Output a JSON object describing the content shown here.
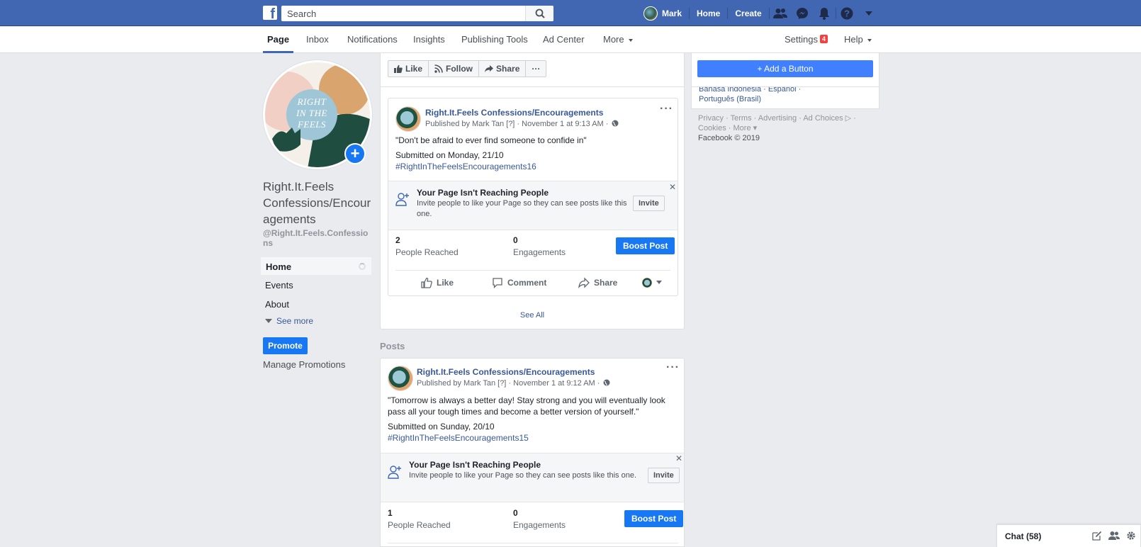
{
  "colors": {
    "brand_blue": "#4267b2",
    "link_blue": "#385898",
    "button_blue": "#1877f2",
    "page_bg": "#e9ebee",
    "notification_red": "#fa3e3e"
  },
  "topbar": {
    "search_placeholder": "Search",
    "user_name": "Mark",
    "home_label": "Home",
    "create_label": "Create",
    "icons": [
      "facebook-logo-icon",
      "search-icon",
      "friend-requests-icon",
      "messenger-icon",
      "notifications-bell-icon",
      "help-icon",
      "account-menu-caret-icon"
    ]
  },
  "pagenav": {
    "tabs": [
      {
        "label": "Page"
      },
      {
        "label": "Inbox"
      },
      {
        "label": "Notifications"
      },
      {
        "label": "Insights"
      },
      {
        "label": "Publishing Tools"
      },
      {
        "label": "Ad Center"
      },
      {
        "label": "More"
      }
    ],
    "settings_label": "Settings",
    "settings_badge": "4",
    "help_label": "Help"
  },
  "left": {
    "page_name": "Right.It.Feels Confessions/Encouragements",
    "page_handle": "@Right.It.Feels.Confessions",
    "profile_pic_text": "RIGHT IN THE FEELS",
    "nav": [
      {
        "label": "Home"
      },
      {
        "label": "Events"
      },
      {
        "label": "About"
      }
    ],
    "see_more": "See more",
    "promote": "Promote",
    "manage_promotions": "Manage Promotions"
  },
  "actions": {
    "like": "Like",
    "follow": "Follow",
    "share": "Share",
    "more": "···"
  },
  "right": {
    "add_button": "+ Add a Button",
    "languages_line1": "Bahasa Indonesia · Español ·",
    "languages_line2": "Português (Brasil)",
    "footer_line1": "Privacy · Terms · Advertising · Ad Choices ▷ ·",
    "footer_line2": "Cookies · More ▾",
    "footer_copyright": "Facebook © 2019"
  },
  "recent_post": {
    "author": "Right.It.Feels Confessions/Encouragements",
    "meta": "Published by Mark Tan [?] · November 1 at 9:13 AM ·",
    "text": "\"Don't be afraid to ever find someone to confide in\"",
    "submitted": "Submitted on Monday, 21/10",
    "hashtag": "#RightInTheFeelsEncouragements16",
    "reach_title": "Your Page Isn't Reaching People",
    "reach_desc": "Invite people to like your Page so they can see posts like this one.",
    "invite": "Invite",
    "people_reached_num": "2",
    "people_reached_label": "People Reached",
    "engagements_num": "0",
    "engagements_label": "Engagements",
    "boost": "Boost Post",
    "like": "Like",
    "comment": "Comment",
    "share": "Share",
    "see_all": "See All"
  },
  "posts_header": "Posts",
  "post2": {
    "author": "Right.It.Feels Confessions/Encouragements",
    "meta": "Published by Mark Tan [?] · November 1 at 9:12 AM ·",
    "text": "\"Tomorrow is always a better day! Stay strong and you will eventually look pass all your tough times and become a better version of yourself.\"",
    "submitted": "Submitted on Sunday, 20/10",
    "hashtag": "#RightInTheFeelsEncouragements15",
    "reach_title": "Your Page Isn't Reaching People",
    "reach_desc": "Invite people to like your Page so they can see posts like this one.",
    "invite": "Invite",
    "people_reached_num": "1",
    "people_reached_label": "People Reached",
    "engagements_num": "0",
    "engagements_label": "Engagements",
    "boost": "Boost Post"
  },
  "chat": {
    "label": "Chat (58)"
  }
}
